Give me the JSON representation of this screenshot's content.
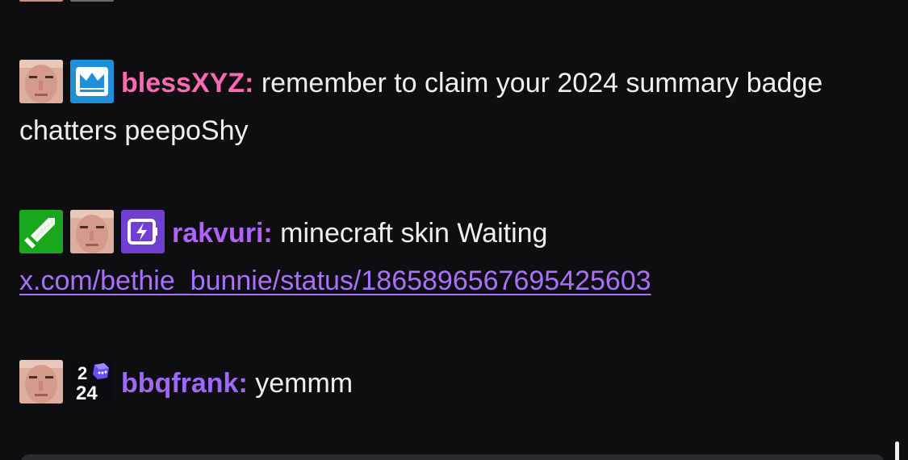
{
  "messages": [
    {
      "username": "blessXYZ",
      "separator": ":",
      "badges": [
        "avatar-badge",
        "crown-icon"
      ],
      "text": " remember to claim your 2024 summary badge chatters peepoShy",
      "username_color": "#ff69b4"
    },
    {
      "username": "rakvuri",
      "separator": ":",
      "badges": [
        "sword-icon",
        "avatar-badge",
        "bolt-icon"
      ],
      "text": " minecraft skin Waiting ",
      "link": "x.com/bethie_bunnie/status/1865896567695425603",
      "username_color": "#b061ff"
    },
    {
      "username": "bbqfrank",
      "separator": ":",
      "badges": [
        "avatar-badge",
        "2024-badge-icon"
      ],
      "text": " yemmm",
      "username_color": "#9f67ff",
      "badge_2024_top": "2",
      "badge_2024_bottom": "24"
    }
  ],
  "colors": {
    "background": "#0e0e10",
    "text": "#efeff1",
    "link": "#a970ff"
  }
}
